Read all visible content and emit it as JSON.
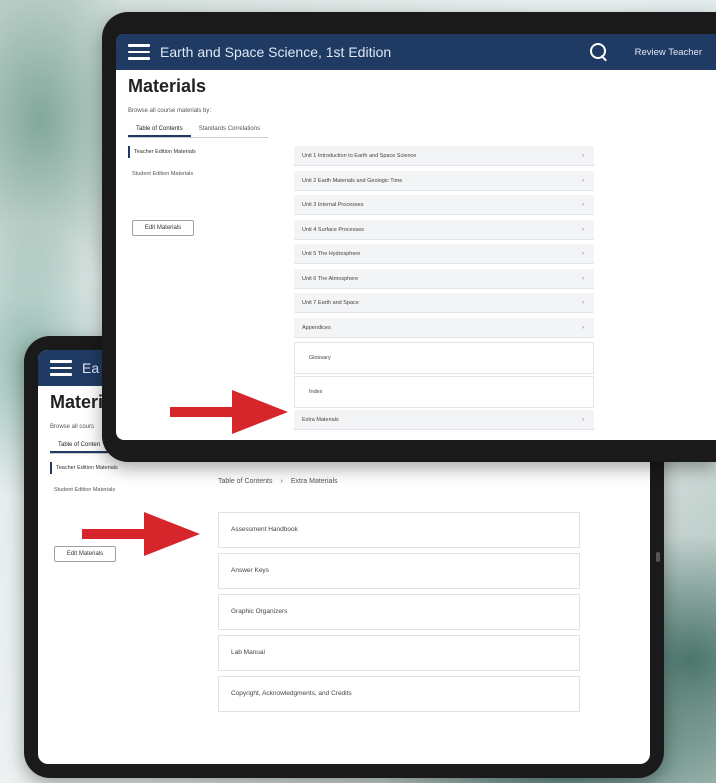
{
  "app": {
    "title": "Earth and Space Science, 1st Edition",
    "title_partial": "Ea",
    "user_label": "Review Teacher"
  },
  "page": {
    "heading": "Materials",
    "heading_partial": "Materi",
    "browse_label": "Browse all course materials by:",
    "browse_label_partial": "Browse all cours"
  },
  "tabs": [
    {
      "label": "Table of Contents",
      "active": true
    },
    {
      "label": "Standards Correlations",
      "active": false
    }
  ],
  "tabs_partial": {
    "label": "Table of Conten"
  },
  "sidebar": {
    "items": [
      {
        "label": "Teacher Edition Materials",
        "active": true
      },
      {
        "label": "Student Edition Materials",
        "active": false
      }
    ],
    "edit_button": "Edit Materials"
  },
  "toc": {
    "units": [
      "Unit 1 Introduction to Earth and Space Science",
      "Unit 2 Earth Materials and Geologic Time",
      "Unit 3 Internal Processes",
      "Unit 4 Surface Processes",
      "Unit 5 The Hydrosphere",
      "Unit 6 The Atmosphere",
      "Unit 7 Earth and Space",
      "Appendices"
    ],
    "appendix_children": [
      "Glossary",
      "Index"
    ],
    "extra": "Extra Materials",
    "chevron": "›"
  },
  "breadcrumb": {
    "root": "Table of Contents",
    "separator": "›",
    "current": "Extra Materials"
  },
  "extra_materials": [
    "Assessment Handbook",
    "Answer Keys",
    "Graphic Organizers",
    "Lab Manual",
    "Copyright, Acknowledgments, and Credits"
  ],
  "colors": {
    "navbar": "#1f3b64",
    "arrow": "#d7262b"
  }
}
